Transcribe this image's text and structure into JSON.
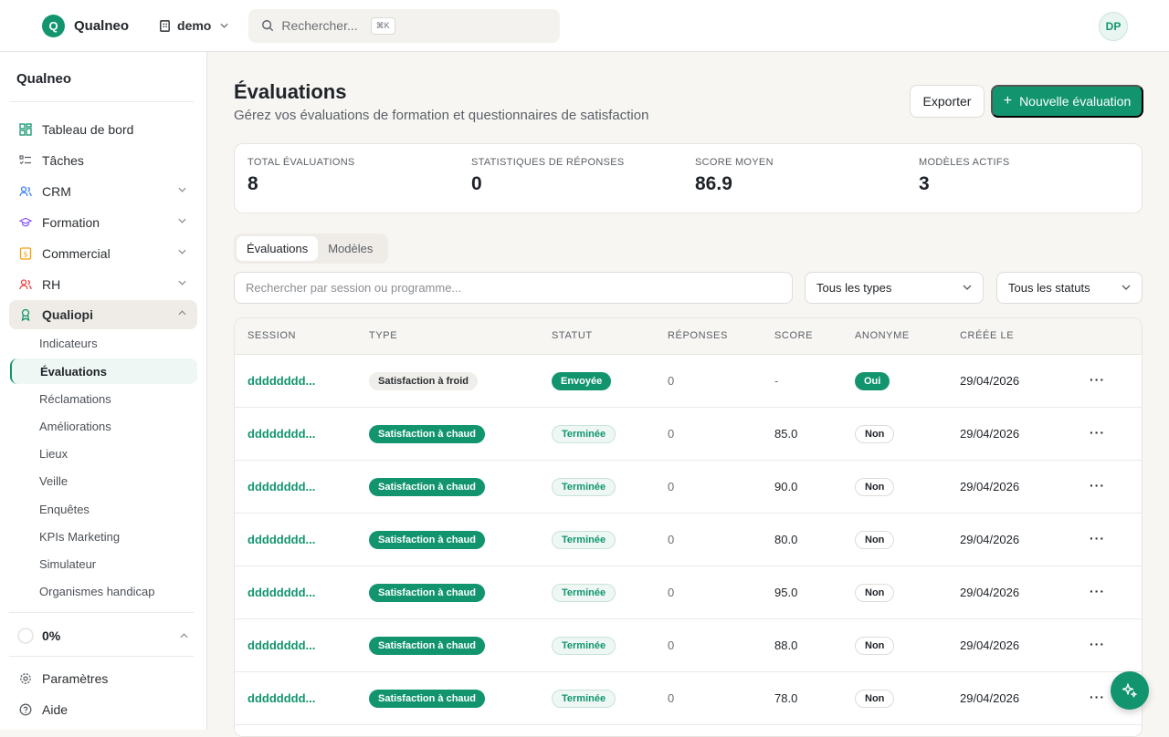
{
  "topbar": {
    "brand_letter": "Q",
    "brand_name": "Qualneo",
    "org_name": "demo",
    "search_placeholder": "Rechercher...",
    "search_shortcut": "⌘K",
    "avatar_initials": "DP"
  },
  "sidebar": {
    "title": "Qualneo",
    "items": [
      {
        "label": "Tableau de bord",
        "icon": "dashboard-icon"
      },
      {
        "label": "Tâches",
        "icon": "tasks-icon"
      },
      {
        "label": "CRM",
        "icon": "users-icon"
      },
      {
        "label": "Formation",
        "icon": "graduation-cap-icon"
      },
      {
        "label": "Commercial",
        "icon": "dollar-icon"
      },
      {
        "label": "RH",
        "icon": "user-group-icon"
      },
      {
        "label": "Qualiopi",
        "icon": "award-icon"
      }
    ],
    "subitems": [
      "Indicateurs",
      "Évaluations",
      "Réclamations",
      "Améliorations",
      "Lieux",
      "Veille",
      "Enquêtes",
      "KPIs Marketing",
      "Simulateur",
      "Organismes handicap"
    ],
    "progress_label": "0%",
    "bottom": [
      {
        "label": "Paramètres",
        "icon": "gear-icon"
      },
      {
        "label": "Aide",
        "icon": "help-icon"
      }
    ]
  },
  "main": {
    "title": "Évaluations",
    "subtitle": "Gérez vos évaluations de formation et questionnaires de satisfaction",
    "export_label": "Exporter",
    "new_label": "Nouvelle évaluation",
    "stats": [
      {
        "label": "TOTAL ÉVALUATIONS",
        "value": "8"
      },
      {
        "label": "STATISTIQUES DE RÉPONSES",
        "value": "0"
      },
      {
        "label": "SCORE MOYEN",
        "value": "86.9"
      },
      {
        "label": "MODÈLES ACTIFS",
        "value": "3"
      }
    ],
    "tabs": [
      "Évaluations",
      "Modèles"
    ],
    "filter_placeholder": "Rechercher par session ou programme...",
    "type_filter": "Tous les types",
    "status_filter": "Tous les statuts",
    "columns": [
      "SESSION",
      "TYPE",
      "STATUT",
      "RÉPONSES",
      "SCORE",
      "ANONYME",
      "CRÉÉE LE"
    ],
    "rows": [
      {
        "session": "dddddddd...",
        "type": "Satisfaction à froid",
        "status": "Envoyée",
        "responses": "0",
        "score": "-",
        "anonymous": "Oui",
        "created": "29/04/2026"
      },
      {
        "session": "dddddddd...",
        "type": "Satisfaction à chaud",
        "status": "Terminée",
        "responses": "0",
        "score": "85.0",
        "anonymous": "Non",
        "created": "29/04/2026"
      },
      {
        "session": "dddddddd...",
        "type": "Satisfaction à chaud",
        "status": "Terminée",
        "responses": "0",
        "score": "90.0",
        "anonymous": "Non",
        "created": "29/04/2026"
      },
      {
        "session": "dddddddd...",
        "type": "Satisfaction à chaud",
        "status": "Terminée",
        "responses": "0",
        "score": "80.0",
        "anonymous": "Non",
        "created": "29/04/2026"
      },
      {
        "session": "dddddddd...",
        "type": "Satisfaction à chaud",
        "status": "Terminée",
        "responses": "0",
        "score": "95.0",
        "anonymous": "Non",
        "created": "29/04/2026"
      },
      {
        "session": "dddddddd...",
        "type": "Satisfaction à chaud",
        "status": "Terminée",
        "responses": "0",
        "score": "88.0",
        "anonymous": "Non",
        "created": "29/04/2026"
      },
      {
        "session": "dddddddd...",
        "type": "Satisfaction à chaud",
        "status": "Terminée",
        "responses": "0",
        "score": "78.0",
        "anonymous": "Non",
        "created": "29/04/2026"
      }
    ]
  },
  "colors": {
    "accent": "#12956f"
  }
}
